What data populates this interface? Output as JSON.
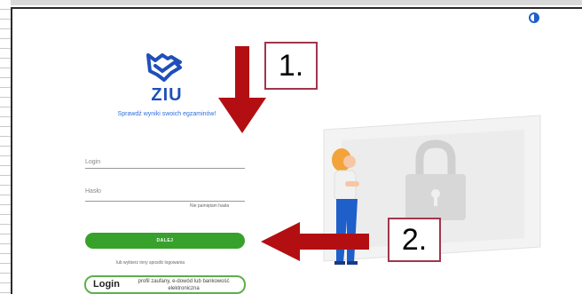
{
  "app": {
    "brand": "ZIU",
    "tagline": "Sprawdź wyniki swoich egzaminów!"
  },
  "form": {
    "login_placeholder": "Login",
    "password_placeholder": "Hasło",
    "forgot_password": "Nie pamiętam hasła",
    "next_button": "DALEJ",
    "other_login_text": "lub wybierz inny sposób logowania",
    "gov_login_word": "Login",
    "gov_login_desc": "profil zaufany, e-dowód lub bankowość elektroniczna"
  },
  "annotations": {
    "step1": "1.",
    "step2": "2."
  },
  "colors": {
    "brand_blue": "#1f4fb8",
    "primary_green": "#37a12c",
    "annotation_red": "#b30f12"
  },
  "icons": {
    "contrast": "contrast-icon",
    "logo": "shield-check-logo",
    "padlock": "padlock-illustration"
  }
}
